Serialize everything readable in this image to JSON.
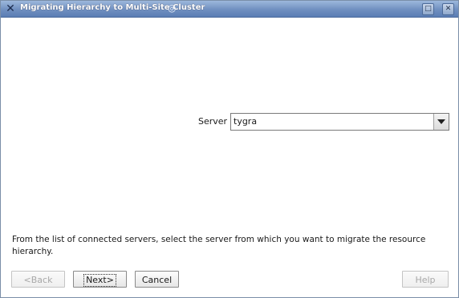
{
  "window": {
    "title": "Migrating Hierarchy to Multi-Site Cluster",
    "title_icon": "x-logo-icon",
    "maximize_glyph": "□",
    "close_glyph": "✕"
  },
  "form": {
    "server_label": "Server",
    "server_value": "tygra"
  },
  "instructions": "From the list of connected servers, select the server from which you want to migrate the resource hierarchy.",
  "buttons": {
    "back": "<Back",
    "next": "Next>",
    "cancel": "Cancel",
    "help": "Help"
  },
  "colors": {
    "titlebar": "#6f8fc0",
    "disabled_text": "#a8a8a8"
  }
}
